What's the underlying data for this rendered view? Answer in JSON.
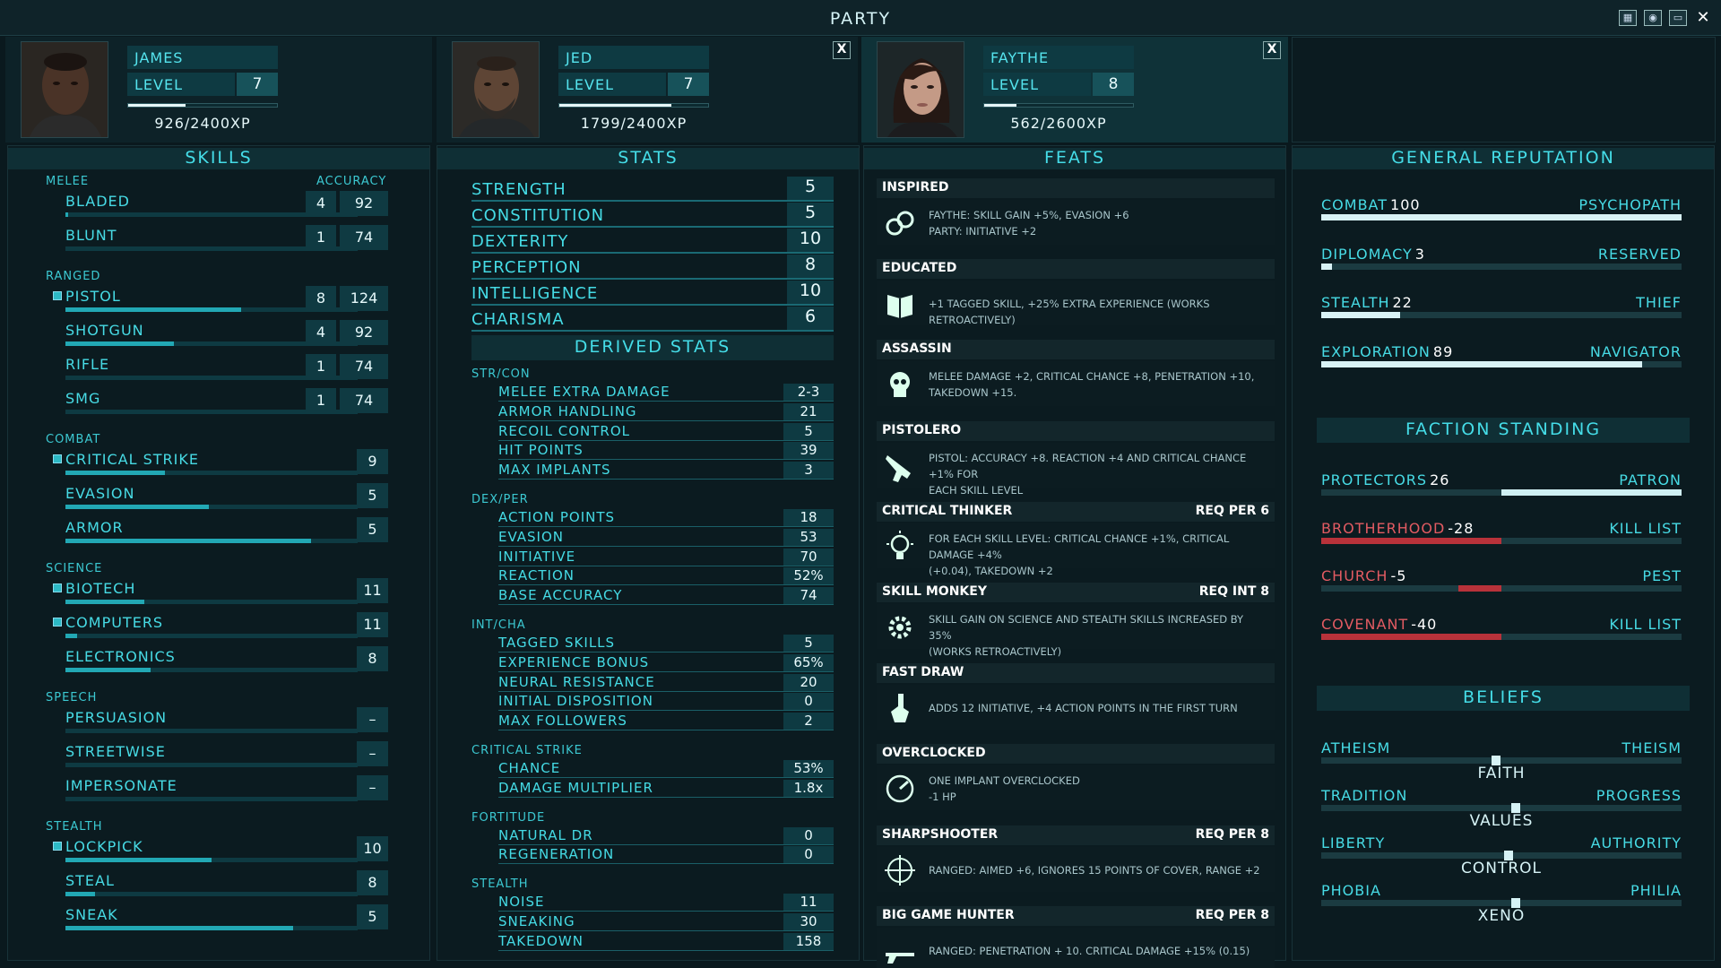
{
  "title": "PARTY",
  "window_icons": [
    "calendar-icon",
    "brain-icon",
    "monitor-icon",
    "close-icon"
  ],
  "party": [
    {
      "name": "JAMES",
      "level_label": "LEVEL",
      "level": "7",
      "xp_text": "926/2400XP",
      "xp_fraction": 0.386,
      "closable": false,
      "selected": false
    },
    {
      "name": "JED",
      "level_label": "LEVEL",
      "level": "7",
      "xp_text": "1799/2400XP",
      "xp_fraction": 0.75,
      "closable": true,
      "close_label": "X",
      "selected": false
    },
    {
      "name": "FAYTHE",
      "level_label": "LEVEL",
      "level": "8",
      "xp_text": "562/2600XP",
      "xp_fraction": 0.216,
      "closable": true,
      "close_label": "X",
      "selected": true
    }
  ],
  "skills": {
    "title": "SKILLS",
    "accuracy_label": "ACCURACY",
    "groups": [
      {
        "name": "MELEE",
        "items": [
          {
            "name": "BLADED",
            "tagged": false,
            "value": "4",
            "accuracy": "92",
            "progress": 0.01
          },
          {
            "name": "BLUNT",
            "tagged": false,
            "value": "1",
            "accuracy": "74",
            "progress": 0
          }
        ]
      },
      {
        "name": "RANGED",
        "items": [
          {
            "name": "PISTOL",
            "tagged": true,
            "value": "8",
            "accuracy": "124",
            "progress": 0.6
          },
          {
            "name": "SHOTGUN",
            "tagged": false,
            "value": "4",
            "accuracy": "92",
            "progress": 0.37
          },
          {
            "name": "RIFLE",
            "tagged": false,
            "value": "1",
            "accuracy": "74",
            "progress": 0
          },
          {
            "name": "SMG",
            "tagged": false,
            "value": "1",
            "accuracy": "74",
            "progress": 0
          }
        ]
      },
      {
        "name": "COMBAT",
        "items": [
          {
            "name": "CRITICAL STRIKE",
            "tagged": true,
            "value": "9",
            "progress": 0.34
          },
          {
            "name": "EVASION",
            "tagged": false,
            "value": "5",
            "progress": 0.49
          },
          {
            "name": "ARMOR",
            "tagged": false,
            "value": "5",
            "progress": 0.84
          }
        ]
      },
      {
        "name": "SCIENCE",
        "items": [
          {
            "name": "BIOTECH",
            "tagged": true,
            "value": "11",
            "progress": 0.27
          },
          {
            "name": "COMPUTERS",
            "tagged": true,
            "value": "11",
            "progress": 0.04
          },
          {
            "name": "ELECTRONICS",
            "tagged": false,
            "value": "8",
            "progress": 0.29
          }
        ]
      },
      {
        "name": "SPEECH",
        "items": [
          {
            "name": "PERSUASION",
            "tagged": false,
            "value": "–",
            "progress": 0
          },
          {
            "name": "STREETWISE",
            "tagged": false,
            "value": "–",
            "progress": 0
          },
          {
            "name": "IMPERSONATE",
            "tagged": false,
            "value": "–",
            "progress": 0
          }
        ]
      },
      {
        "name": "STEALTH",
        "items": [
          {
            "name": "LOCKPICK",
            "tagged": true,
            "value": "10",
            "progress": 0.5
          },
          {
            "name": "STEAL",
            "tagged": false,
            "value": "8",
            "progress": 0.1
          },
          {
            "name": "SNEAK",
            "tagged": false,
            "value": "5",
            "progress": 0.78
          }
        ]
      }
    ]
  },
  "stats": {
    "title": "STATS",
    "primary": [
      {
        "name": "STRENGTH",
        "value": "5"
      },
      {
        "name": "CONSTITUTION",
        "value": "5"
      },
      {
        "name": "DEXTERITY",
        "value": "10"
      },
      {
        "name": "PERCEPTION",
        "value": "8"
      },
      {
        "name": "INTELLIGENCE",
        "value": "10"
      },
      {
        "name": "CHARISMA",
        "value": "6"
      }
    ],
    "derived_title": "DERIVED STATS",
    "derived": [
      {
        "name": "STR/CON",
        "rows": [
          {
            "name": "MELEE EXTRA DAMAGE",
            "value": "2-3"
          },
          {
            "name": "ARMOR HANDLING",
            "value": "21"
          },
          {
            "name": "RECOIL CONTROL",
            "value": "5"
          },
          {
            "name": "HIT POINTS",
            "value": "39"
          },
          {
            "name": "MAX IMPLANTS",
            "value": "3"
          }
        ]
      },
      {
        "name": "DEX/PER",
        "rows": [
          {
            "name": "ACTION POINTS",
            "value": "18"
          },
          {
            "name": "EVASION",
            "value": "53"
          },
          {
            "name": "INITIATIVE",
            "value": "70"
          },
          {
            "name": "REACTION",
            "value": "52%"
          },
          {
            "name": "BASE ACCURACY",
            "value": "74"
          }
        ]
      },
      {
        "name": "INT/CHA",
        "rows": [
          {
            "name": "TAGGED SKILLS",
            "value": "5"
          },
          {
            "name": "EXPERIENCE BONUS",
            "value": "65%"
          },
          {
            "name": "NEURAL RESISTANCE",
            "value": "20"
          },
          {
            "name": "INITIAL DISPOSITION",
            "value": "0"
          },
          {
            "name": "MAX FOLLOWERS",
            "value": "2"
          }
        ]
      },
      {
        "name": "CRITICAL STRIKE",
        "rows": [
          {
            "name": "CHANCE",
            "value": "53%"
          },
          {
            "name": "DAMAGE MULTIPLIER",
            "value": "1.8x"
          }
        ]
      },
      {
        "name": "FORTITUDE",
        "rows": [
          {
            "name": "NATURAL DR",
            "value": "0"
          },
          {
            "name": "REGENERATION",
            "value": "0"
          }
        ]
      },
      {
        "name": "STEALTH",
        "rows": [
          {
            "name": "NOISE",
            "value": "11"
          },
          {
            "name": "SNEAKING",
            "value": "30"
          },
          {
            "name": "TAKEDOWN",
            "value": "158"
          }
        ]
      }
    ]
  },
  "feats": {
    "title": "FEATS",
    "items": [
      {
        "name": "INSPIRED",
        "req": "",
        "icon": "chain-link-icon",
        "desc1": "FAYTHE: SKILL GAIN +5%, EVASION +6",
        "desc2": "PARTY: INITIATIVE +2"
      },
      {
        "name": "EDUCATED",
        "req": "",
        "icon": "book-icon",
        "desc1": "+1 TAGGED SKILL, +25% EXTRA EXPERIENCE (WORKS RETROACTIVELY)",
        "desc2": ""
      },
      {
        "name": "ASSASSIN",
        "req": "",
        "icon": "skull-icon",
        "desc1": "MELEE DAMAGE +2, CRITICAL CHANCE +8, PENETRATION +10,",
        "desc2": "TAKEDOWN +15."
      },
      {
        "name": "PISTOLERO",
        "req": "",
        "icon": "pistol-icon",
        "desc1": "PISTOL: ACCURACY +8. REACTION +4 AND CRITICAL CHANCE +1% FOR",
        "desc2": "EACH SKILL LEVEL"
      },
      {
        "name": "CRITICAL THINKER",
        "req": "REQ PER 6",
        "icon": "lightbulb-icon",
        "desc1": "FOR EACH SKILL LEVEL: CRITICAL CHANCE +1%, CRITICAL DAMAGE +4%",
        "desc2": "(+0.04), TAKEDOWN +2"
      },
      {
        "name": "SKILL MONKEY",
        "req": "REQ INT 8",
        "icon": "gears-icon",
        "desc1": "SKILL GAIN ON SCIENCE AND STEALTH SKILLS INCREASED BY 35%",
        "desc2": "(WORKS RETROACTIVELY)"
      },
      {
        "name": "FAST DRAW",
        "req": "",
        "icon": "draw-hand-icon",
        "desc1": "ADDS 12 INITIATIVE, +4 ACTION POINTS IN THE FIRST TURN",
        "desc2": ""
      },
      {
        "name": "OVERCLOCKED",
        "req": "",
        "icon": "gauge-icon",
        "desc1": "ONE IMPLANT OVERCLOCKED",
        "desc2": "-1 HP"
      },
      {
        "name": "SHARPSHOOTER",
        "req": "REQ PER 8",
        "icon": "crosshair-icon",
        "desc1": "RANGED: AIMED +6, IGNORES 15 POINTS OF COVER, RANGE +2",
        "desc2": ""
      },
      {
        "name": "BIG GAME HUNTER",
        "req": "REQ PER 8",
        "icon": "rifle-icon",
        "desc1": "RANGED: PENETRATION + 10. CRITICAL DAMAGE +15% (0.15)",
        "desc2": ""
      }
    ]
  },
  "reputation": {
    "title": "GENERAL REPUTATION",
    "items": [
      {
        "name": "COMBAT",
        "value": "100",
        "rank": "PSYCHOPATH",
        "fraction": 1.0
      },
      {
        "name": "DIPLOMACY",
        "value": "3",
        "rank": "RESERVED",
        "fraction": 0.03
      },
      {
        "name": "STEALTH",
        "value": "22",
        "rank": "THIEF",
        "fraction": 0.22
      },
      {
        "name": "EXPLORATION",
        "value": "89",
        "rank": "NAVIGATOR",
        "fraction": 0.89
      }
    ]
  },
  "factions": {
    "title": "FACTION STANDING",
    "items": [
      {
        "name": "PROTECTORS",
        "value": "26",
        "rank": "PATRON",
        "signed": 0.5,
        "color": "#cfeff2"
      },
      {
        "name": "BROTHERHOOD",
        "value": "-28",
        "rank": "KILL LIST",
        "signed": -0.5,
        "color": "#b8323a"
      },
      {
        "name": "CHURCH",
        "value": "-5",
        "rank": "PEST",
        "signed": -0.12,
        "color": "#b8323a"
      },
      {
        "name": "COVENANT",
        "value": "-40",
        "rank": "KILL LIST",
        "signed": -0.5,
        "color": "#b8323a"
      }
    ]
  },
  "beliefs": {
    "title": "BELIEFS",
    "items": [
      {
        "left": "ATHEISM",
        "right": "THEISM",
        "center": "FAITH",
        "position": 0.485
      },
      {
        "left": "TRADITION",
        "right": "PROGRESS",
        "center": "VALUES",
        "position": 0.54
      },
      {
        "left": "LIBERTY",
        "right": "AUTHORITY",
        "center": "CONTROL",
        "position": 0.52
      },
      {
        "left": "PHOBIA",
        "right": "PHILIA",
        "center": "XENO",
        "position": 0.54
      }
    ]
  }
}
